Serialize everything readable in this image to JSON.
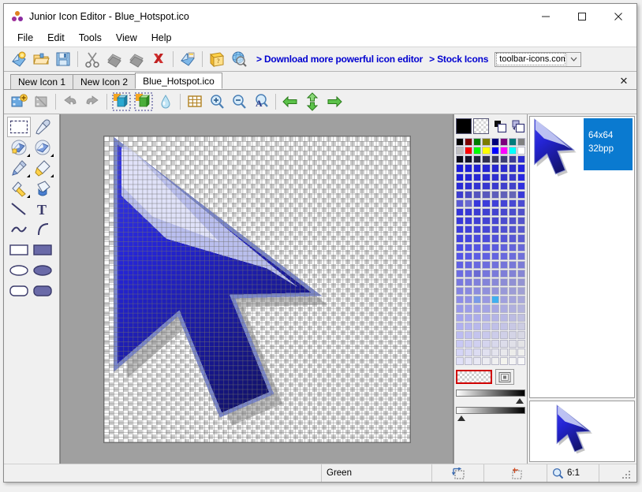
{
  "window": {
    "title": "Junior Icon Editor - Blue_Hotspot.ico",
    "app_icon": "three-dots-icon",
    "minimize": "—",
    "maximize": "☐",
    "close": "✕"
  },
  "menu": {
    "items": [
      {
        "label": "File",
        "name": "menu-file"
      },
      {
        "label": "Edit",
        "name": "menu-edit"
      },
      {
        "label": "Tools",
        "name": "menu-tools"
      },
      {
        "label": "View",
        "name": "menu-view"
      },
      {
        "label": "Help",
        "name": "menu-help"
      }
    ]
  },
  "toolbar_main": {
    "buttons": [
      {
        "name": "new-icon-button",
        "icon": "new-document-icon",
        "tooltip": "New"
      },
      {
        "name": "open-icon-button",
        "icon": "open-folder-icon",
        "tooltip": "Open"
      },
      {
        "name": "save-icon-button",
        "icon": "floppy-disk-icon",
        "tooltip": "Save"
      },
      {
        "name": "cut-button",
        "icon": "scissors-icon",
        "tooltip": "Cut"
      },
      {
        "name": "copy-button",
        "icon": "copy-pages-icon",
        "tooltip": "Copy"
      },
      {
        "name": "paste-button",
        "icon": "paste-pages-icon",
        "tooltip": "Paste"
      },
      {
        "name": "delete-button",
        "icon": "red-x-icon",
        "tooltip": "Delete"
      },
      {
        "name": "import-image-button",
        "icon": "blue-import-icon",
        "tooltip": "Import"
      },
      {
        "name": "help-topics-button",
        "icon": "yellow-question-book-icon",
        "tooltip": "Help"
      },
      {
        "name": "search-web-button",
        "icon": "globe-magnifier-icon",
        "tooltip": "Search"
      }
    ],
    "download_link": "> Download more powerful icon editor",
    "stock_icons_link": "> Stock Icons",
    "site_combo": {
      "value": "toolbar-icons.com",
      "arrow": "∨"
    }
  },
  "tabs": {
    "items": [
      {
        "label": "New Icon 1",
        "name": "tab-new-icon-1",
        "active": false
      },
      {
        "label": "New Icon 2",
        "name": "tab-new-icon-2",
        "active": false
      },
      {
        "label": "Blue_Hotspot.ico",
        "name": "tab-blue-hotspot",
        "active": true
      }
    ],
    "close_label": "✕"
  },
  "toolbar_edit": {
    "buttons": [
      {
        "name": "add-image-button",
        "icon": "add-film-icon"
      },
      {
        "name": "remove-image-button",
        "icon": "remove-film-icon"
      },
      {
        "name": "undo-button",
        "icon": "undo-arrow-icon"
      },
      {
        "name": "redo-button",
        "icon": "redo-arrow-icon"
      },
      {
        "name": "image-format-blue-button",
        "icon": "blue-cube-icon"
      },
      {
        "name": "image-format-green-button",
        "icon": "green-cube-icon"
      },
      {
        "name": "smooth-button",
        "icon": "water-drop-icon"
      },
      {
        "name": "toggle-grid-button",
        "icon": "grid-icon"
      },
      {
        "name": "zoom-in-button",
        "icon": "magnifier-plus-icon"
      },
      {
        "name": "zoom-out-button",
        "icon": "magnifier-minus-icon"
      },
      {
        "name": "actual-size-button",
        "icon": "magnifier-letter-a-icon"
      },
      {
        "name": "nav-left-button",
        "icon": "green-arrow-left-icon"
      },
      {
        "name": "nav-vertical-button",
        "icon": "green-arrow-updown-icon"
      },
      {
        "name": "nav-right-button",
        "icon": "green-arrow-right-icon"
      }
    ]
  },
  "tools": {
    "items": [
      {
        "name": "tool-rectangular-select",
        "icon": "dashed-rectangle-icon",
        "selected": true,
        "submenu": false
      },
      {
        "name": "tool-color-picker",
        "icon": "eyedropper-icon",
        "selected": false,
        "submenu": false
      },
      {
        "name": "tool-eraser",
        "icon": "eraser-icon",
        "selected": false,
        "submenu": true
      },
      {
        "name": "tool-eraser-alt",
        "icon": "eraser-alt-icon",
        "selected": false,
        "submenu": true
      },
      {
        "name": "tool-pencil",
        "icon": "pencil-icon",
        "selected": false,
        "submenu": true
      },
      {
        "name": "tool-brush",
        "icon": "brush-icon",
        "selected": false,
        "submenu": true
      },
      {
        "name": "tool-airbrush",
        "icon": "airbrush-icon",
        "selected": false,
        "submenu": true
      },
      {
        "name": "tool-paint-bucket",
        "icon": "paint-bucket-icon",
        "selected": false,
        "submenu": false
      },
      {
        "name": "tool-line",
        "icon": "line-icon",
        "selected": false,
        "submenu": false
      },
      {
        "name": "tool-text",
        "icon": "text-t-icon",
        "selected": false,
        "submenu": false
      },
      {
        "name": "tool-curve",
        "icon": "curve-icon",
        "selected": false,
        "submenu": false
      },
      {
        "name": "tool-arc",
        "icon": "arc-icon",
        "selected": false,
        "submenu": false
      },
      {
        "name": "tool-rectangle-outline",
        "icon": "rectangle-outline-icon",
        "selected": false,
        "submenu": false
      },
      {
        "name": "tool-rectangle-filled",
        "icon": "rectangle-filled-icon",
        "selected": false,
        "submenu": false
      },
      {
        "name": "tool-ellipse-outline",
        "icon": "ellipse-outline-icon",
        "selected": false,
        "submenu": false
      },
      {
        "name": "tool-ellipse-filled",
        "icon": "ellipse-filled-icon",
        "selected": false,
        "submenu": false
      },
      {
        "name": "tool-rounded-rect-outline",
        "icon": "rounded-rect-outline-icon",
        "selected": false,
        "submenu": false
      },
      {
        "name": "tool-rounded-rect-filled",
        "icon": "rounded-rect-filled-icon",
        "selected": false,
        "submenu": false
      }
    ]
  },
  "palette": {
    "foreground_color": "#000000",
    "background_color": "transparent",
    "swap_icon": "swap-colors-icon",
    "more_colors_icon": "concentric-squares-icon",
    "transparent_label": "transparent-swatch",
    "colors": [
      "#000000",
      "#7b0000",
      "#007b00",
      "#7b7b00",
      "#00007b",
      "#7b007b",
      "#007b7b",
      "#808080",
      "#c0c0c0",
      "#ff0000",
      "#00ff00",
      "#ffff00",
      "#0000ff",
      "#ff00ff",
      "#00ffff",
      "#ffffff",
      "#0b0b18",
      "#141428",
      "#22223c",
      "#30304f",
      "#3b3b60",
      "#3f3f73",
      "#3c3c96",
      "#2a2ad0",
      "#1a1ad8",
      "#1e1ed6",
      "#2020d4",
      "#2424d2",
      "#2626d0",
      "#2a2ace",
      "#2e2ecc",
      "#2424e0",
      "#2020d8",
      "#2424d6",
      "#2828d4",
      "#2c2cd2",
      "#3030d0",
      "#3434ce",
      "#3838cc",
      "#2828e2",
      "#2a2ad6",
      "#2e2ed4",
      "#3232d2",
      "#3636d0",
      "#3a3ace",
      "#3e3ecc",
      "#4242ca",
      "#3030e0",
      "#3c3cd0",
      "#4a4ac4",
      "#5454bf",
      "#5858bd",
      "#5c5cbb",
      "#6060b9",
      "#6464b7",
      "#3a3ad8",
      "#5a5ad4",
      "#6a6ad0",
      "#3838dc",
      "#3c3cda",
      "#4040d8",
      "#4444d6",
      "#4848d4",
      "#4c4cd2",
      "#3434d8",
      "#3838d6",
      "#3c3cd4",
      "#4040d2",
      "#4444d0",
      "#4848ce",
      "#4c4ccc",
      "#5050ca",
      "#3838da",
      "#3c3cd8",
      "#4040d6",
      "#4444d4",
      "#4848d2",
      "#4c4cd0",
      "#5050ce",
      "#5454cc",
      "#3c3cdc",
      "#4040da",
      "#4444d8",
      "#4848d6",
      "#4c4cd4",
      "#5050d2",
      "#5454d0",
      "#5858ce",
      "#4040e0",
      "#4444de",
      "#4848dc",
      "#4c4cda",
      "#5050d8",
      "#5454d6",
      "#5858d4",
      "#5c5cd2",
      "#4c4ce6",
      "#5050e4",
      "#5454e2",
      "#5858e0",
      "#5c5cde",
      "#6060dc",
      "#6464da",
      "#6868d8",
      "#5454e8",
      "#5858e6",
      "#5c5ce4",
      "#6060e2",
      "#6464e0",
      "#6868de",
      "#6c6cdc",
      "#7070da",
      "#6060e4",
      "#6464e2",
      "#6868e0",
      "#6c6cde",
      "#7070dc",
      "#7474da",
      "#7878d8",
      "#7c7cd6",
      "#6c6ce2",
      "#7070e0",
      "#6a6ad4",
      "#7676dc",
      "#7a7ada",
      "#7e7ed8",
      "#8282d6",
      "#8686d4",
      "#7878e0",
      "#7c7cde",
      "#8080dc",
      "#8484da",
      "#8888d8",
      "#8c8cd6",
      "#9090d4",
      "#9494d2",
      "#8484e2",
      "#8888e0",
      "#8c8cde",
      "#9090dc",
      "#9494da",
      "#9898d8",
      "#9c9cd6",
      "#a0a0d4",
      "#8c8ce8",
      "#9090e6",
      "#7a9ae8",
      "#9898e2",
      "#40b0f0",
      "#a0a0de",
      "#a4a4dc",
      "#a8a8da",
      "#9898ea",
      "#9c9ce8",
      "#a0a0e6",
      "#a4a4e4",
      "#a8a8e2",
      "#acace0",
      "#b0b0de",
      "#b4b4dc",
      "#a4a4ee",
      "#a8a8ec",
      "#acacea",
      "#b0b0e8",
      "#b4b4e6",
      "#b8b8e4",
      "#bcbce2",
      "#c0c0e0",
      "#b0b0f0",
      "#b4b4ee",
      "#b8b8ec",
      "#bcbcea",
      "#c0c0e8",
      "#c4c4e6",
      "#c8c8e4",
      "#ccc cE2",
      "#bcbcf2",
      "#c0c0f0",
      "#c4c4ee",
      "#c8c8ec",
      "#ccccea",
      "#d0d0e8",
      "#d4d4e6",
      "#d8d8e4",
      "#c8c8f4",
      "#ccccf2",
      "#d0d0f0",
      "#d4d4ee",
      "#d8d8ec",
      "#dcdcea",
      "#e0e0e8",
      "#e4e4e6",
      "#d4d4f6",
      "#d8d8f4",
      "#dcdcf2",
      "#e0e0f0",
      "#e4e4ee",
      "#e8e8ec",
      "#ececea",
      "#f0f0ee",
      "#e0e0f8",
      "#e4e4f6",
      "#e8e8f4",
      "#ececf2",
      "#f0f0f0",
      "#f4f4ee",
      "#f4f4f4",
      "#f8f8f8"
    ]
  },
  "preview": {
    "size_label": "64x64",
    "depth_label": "32bpp",
    "main_icon": "blue-cursor-arrow-icon",
    "small_icon": "blue-cursor-arrow-icon"
  },
  "statusbar": {
    "color_name": "Green",
    "selection_icon": "selection-size-icon",
    "hotspot_icon": "hotspot-crosshair-icon",
    "zoom_icon": "magnifier-icon",
    "zoom_level": "6:1",
    "grip_icon": "resize-grip-icon"
  },
  "canvas": {
    "artwork": "blue-cursor-arrow-icon",
    "grid_visible": true,
    "background": "transparent-checker"
  }
}
